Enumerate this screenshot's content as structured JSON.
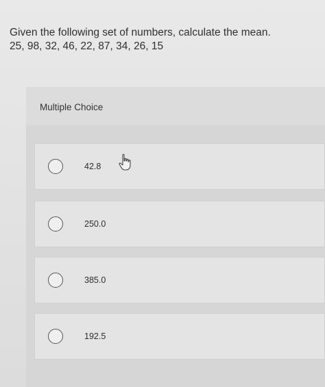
{
  "question": {
    "line1": "Given the following set of numbers, calculate the mean.",
    "line2": "25, 98, 32, 46, 22, 87, 34, 26, 15"
  },
  "multiple_choice": {
    "header": "Multiple Choice",
    "options": [
      {
        "label": "42.8"
      },
      {
        "label": "250.0"
      },
      {
        "label": "385.0"
      },
      {
        "label": "192.5"
      }
    ]
  },
  "icons": {
    "cursor": "hand-pointer-icon",
    "radio": "radio-unselected-icon"
  },
  "colors": {
    "background": "#e6e6e6",
    "option_background": "#e4e4e4",
    "text": "#2b2b2b"
  }
}
